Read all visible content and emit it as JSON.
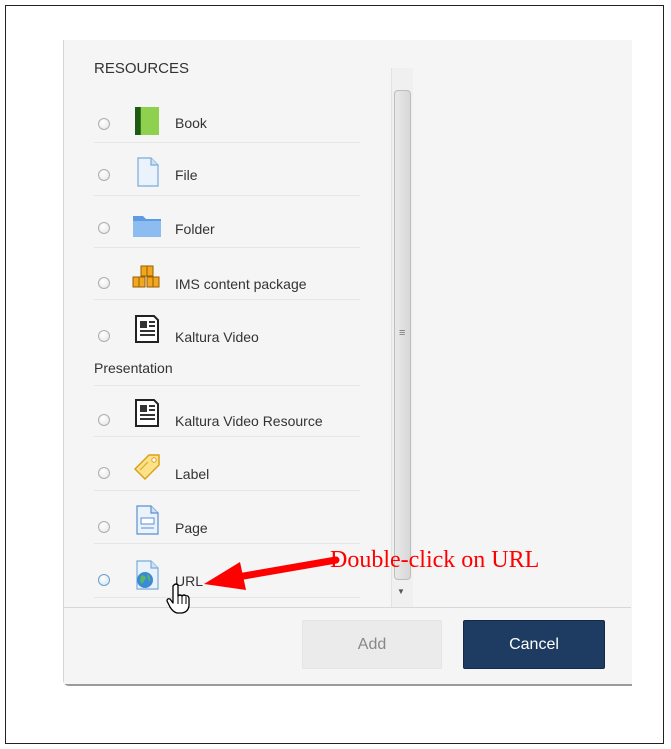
{
  "resources": {
    "title": "RESOURCES",
    "items": [
      {
        "label": "Book",
        "icon": "book-icon"
      },
      {
        "label": "File",
        "icon": "file-icon"
      },
      {
        "label": "Folder",
        "icon": "folder-icon"
      },
      {
        "label": "IMS content package",
        "icon": "ims-package-icon"
      },
      {
        "label": "Kaltura Video",
        "label_line2": "Presentation",
        "icon": "kaltura-icon"
      },
      {
        "label": "Kaltura Video Resource",
        "icon": "kaltura-icon"
      },
      {
        "label": "Label",
        "icon": "label-tag-icon"
      },
      {
        "label": "Page",
        "icon": "page-icon"
      },
      {
        "label": "URL",
        "icon": "url-globe-icon"
      }
    ]
  },
  "footer": {
    "add_label": "Add",
    "cancel_label": "Cancel"
  },
  "annotation": {
    "text": "Double-click on URL",
    "color": "#ff0000"
  },
  "colors": {
    "cancel_bg": "#1e3b62",
    "dialog_bg": "#f5f5f5"
  }
}
